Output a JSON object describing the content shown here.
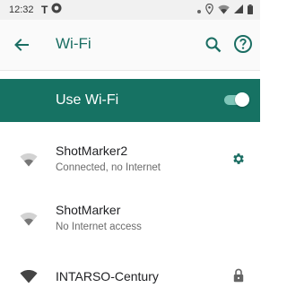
{
  "status_bar": {
    "time": "12:32",
    "left_icons": [
      "carrier-t-icon",
      "android-notification-icon"
    ],
    "right_icons": [
      "dot-icon",
      "location-icon",
      "wifi-icon",
      "signal-icon",
      "battery-icon"
    ]
  },
  "app_bar": {
    "title": "Wi-Fi",
    "back_icon": "arrow-back-icon",
    "actions": [
      "search-icon",
      "help-icon"
    ]
  },
  "use_wifi": {
    "label": "Use Wi-Fi",
    "enabled": true
  },
  "networks": [
    {
      "name": "ShotMarker2",
      "status": "Connected, no Internet",
      "signal": "weak-partial",
      "trailing_icon": "gear-icon"
    },
    {
      "name": "ShotMarker",
      "status": "No Internet access",
      "signal": "weak-partial",
      "trailing_icon": ""
    },
    {
      "name": "INTARSO-Century",
      "status": "",
      "signal": "full",
      "trailing_icon": "lock-icon"
    }
  ],
  "colors": {
    "accent": "#167263",
    "title": "#1b6e63",
    "statusbar": "#f1f1f1"
  }
}
